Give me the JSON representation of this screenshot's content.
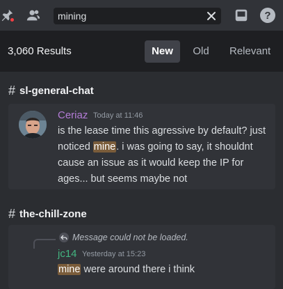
{
  "toolbar": {
    "search_value": "mining",
    "icons": [
      "pin-icon",
      "members-icon",
      "clear-icon",
      "inbox-icon",
      "help-icon"
    ]
  },
  "results": {
    "count_label": "3,060 Results",
    "sort_tabs": [
      {
        "label": "New",
        "active": true
      },
      {
        "label": "Old",
        "active": false
      },
      {
        "label": "Relevant",
        "active": false
      }
    ]
  },
  "groups": [
    {
      "channel": "sl-general-chat",
      "message": {
        "author": "Ceriaz",
        "timestamp": "Today at 11:46",
        "text_before": "is the lease time this agressive by default? just noticed ",
        "highlight": "mine",
        "text_after": ". i was going to say, it shouldnt cause an issue as it would keep the IP for ages... but seems maybe not"
      }
    },
    {
      "channel": "the-chill-zone",
      "message": {
        "reply_notice": "Message could not be loaded.",
        "author": "jc14",
        "timestamp": "Yesterday at 15:23",
        "highlight": "mine",
        "text_after": " were around there i think"
      }
    }
  ],
  "colors": {
    "highlight_bg": "#7a5c3a",
    "author_1": "#b47cd7",
    "author_2": "#43b581",
    "notification_dot": "#f23f43"
  }
}
